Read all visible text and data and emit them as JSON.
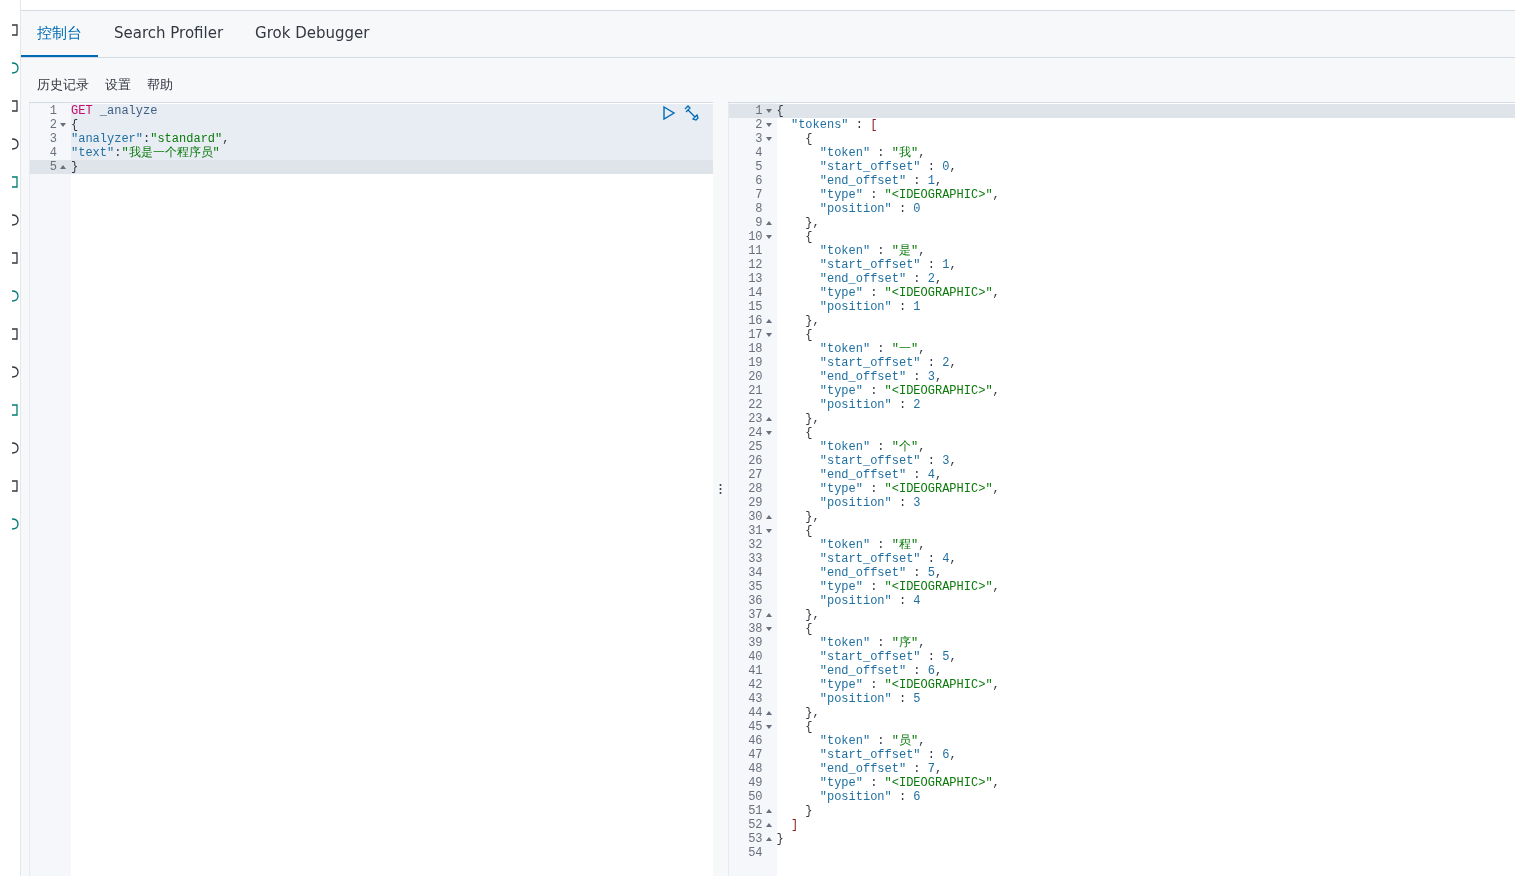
{
  "tabs": [
    {
      "label": "控制台",
      "selected": true
    },
    {
      "label": "Search Profiler",
      "selected": false
    },
    {
      "label": "Grok Debugger",
      "selected": false
    }
  ],
  "toolbar": [
    "历史记录",
    "设置",
    "帮助"
  ],
  "request": {
    "lines": [
      {
        "n": "1",
        "active": false,
        "kind": "plain",
        "parts": [
          {
            "kind": "method",
            "text": "GET"
          },
          {
            "kind": "path",
            "text": " _analyze"
          }
        ]
      },
      {
        "n": "2",
        "active": false,
        "kind": "fold-start",
        "parts": [
          {
            "kind": "punct",
            "text": "{"
          }
        ]
      },
      {
        "n": "3",
        "active": false,
        "kind": "plain",
        "parts": [
          {
            "kind": "key",
            "text": "\"analyzer\""
          },
          {
            "kind": "punct",
            "text": ":"
          },
          {
            "kind": "string",
            "text": "\"standard\""
          },
          {
            "kind": "punct",
            "text": ","
          }
        ]
      },
      {
        "n": "4",
        "active": false,
        "kind": "plain",
        "parts": [
          {
            "kind": "key",
            "text": "\"text\""
          },
          {
            "kind": "punct",
            "text": ":"
          },
          {
            "kind": "string",
            "text": "\"我是一个程序员\""
          }
        ]
      },
      {
        "n": "5",
        "active": true,
        "kind": "fold-end",
        "parts": [
          {
            "kind": "punct",
            "text": "}"
          }
        ]
      }
    ]
  },
  "response": {
    "lines": [
      {
        "n": "1",
        "active": true,
        "kind": "fold-start",
        "parts": [
          {
            "kind": "punct",
            "text": "{"
          }
        ]
      },
      {
        "n": "2",
        "active": false,
        "kind": "fold-start",
        "parts": [
          {
            "kind": "key",
            "text": "  \"tokens\""
          },
          {
            "kind": "punct",
            "text": " : "
          },
          {
            "kind": "bracket",
            "text": "["
          }
        ]
      },
      {
        "n": "3",
        "active": false,
        "kind": "fold-start",
        "parts": [
          {
            "kind": "punct",
            "text": "    {"
          }
        ]
      },
      {
        "n": "4",
        "active": false,
        "kind": "plain",
        "parts": [
          {
            "kind": "key",
            "text": "      \"token\""
          },
          {
            "kind": "punct",
            "text": " : "
          },
          {
            "kind": "string",
            "text": "\"我\""
          },
          {
            "kind": "punct",
            "text": ","
          }
        ]
      },
      {
        "n": "5",
        "active": false,
        "kind": "plain",
        "parts": [
          {
            "kind": "key",
            "text": "      \"start_offset\""
          },
          {
            "kind": "punct",
            "text": " : "
          },
          {
            "kind": "number",
            "text": "0"
          },
          {
            "kind": "punct",
            "text": ","
          }
        ]
      },
      {
        "n": "6",
        "active": false,
        "kind": "plain",
        "parts": [
          {
            "kind": "key",
            "text": "      \"end_offset\""
          },
          {
            "kind": "punct",
            "text": " : "
          },
          {
            "kind": "number",
            "text": "1"
          },
          {
            "kind": "punct",
            "text": ","
          }
        ]
      },
      {
        "n": "7",
        "active": false,
        "kind": "plain",
        "parts": [
          {
            "kind": "key",
            "text": "      \"type\""
          },
          {
            "kind": "punct",
            "text": " : "
          },
          {
            "kind": "string",
            "text": "\"<IDEOGRAPHIC>\""
          },
          {
            "kind": "punct",
            "text": ","
          }
        ]
      },
      {
        "n": "8",
        "active": false,
        "kind": "plain",
        "parts": [
          {
            "kind": "key",
            "text": "      \"position\""
          },
          {
            "kind": "punct",
            "text": " : "
          },
          {
            "kind": "number",
            "text": "0"
          }
        ]
      },
      {
        "n": "9",
        "active": false,
        "kind": "fold-end",
        "parts": [
          {
            "kind": "punct",
            "text": "    },"
          }
        ]
      },
      {
        "n": "10",
        "active": false,
        "kind": "fold-start",
        "parts": [
          {
            "kind": "punct",
            "text": "    {"
          }
        ]
      },
      {
        "n": "11",
        "active": false,
        "kind": "plain",
        "parts": [
          {
            "kind": "key",
            "text": "      \"token\""
          },
          {
            "kind": "punct",
            "text": " : "
          },
          {
            "kind": "string",
            "text": "\"是\""
          },
          {
            "kind": "punct",
            "text": ","
          }
        ]
      },
      {
        "n": "12",
        "active": false,
        "kind": "plain",
        "parts": [
          {
            "kind": "key",
            "text": "      \"start_offset\""
          },
          {
            "kind": "punct",
            "text": " : "
          },
          {
            "kind": "number",
            "text": "1"
          },
          {
            "kind": "punct",
            "text": ","
          }
        ]
      },
      {
        "n": "13",
        "active": false,
        "kind": "plain",
        "parts": [
          {
            "kind": "key",
            "text": "      \"end_offset\""
          },
          {
            "kind": "punct",
            "text": " : "
          },
          {
            "kind": "number",
            "text": "2"
          },
          {
            "kind": "punct",
            "text": ","
          }
        ]
      },
      {
        "n": "14",
        "active": false,
        "kind": "plain",
        "parts": [
          {
            "kind": "key",
            "text": "      \"type\""
          },
          {
            "kind": "punct",
            "text": " : "
          },
          {
            "kind": "string",
            "text": "\"<IDEOGRAPHIC>\""
          },
          {
            "kind": "punct",
            "text": ","
          }
        ]
      },
      {
        "n": "15",
        "active": false,
        "kind": "plain",
        "parts": [
          {
            "kind": "key",
            "text": "      \"position\""
          },
          {
            "kind": "punct",
            "text": " : "
          },
          {
            "kind": "number",
            "text": "1"
          }
        ]
      },
      {
        "n": "16",
        "active": false,
        "kind": "fold-end",
        "parts": [
          {
            "kind": "punct",
            "text": "    },"
          }
        ]
      },
      {
        "n": "17",
        "active": false,
        "kind": "fold-start",
        "parts": [
          {
            "kind": "punct",
            "text": "    {"
          }
        ]
      },
      {
        "n": "18",
        "active": false,
        "kind": "plain",
        "parts": [
          {
            "kind": "key",
            "text": "      \"token\""
          },
          {
            "kind": "punct",
            "text": " : "
          },
          {
            "kind": "string",
            "text": "\"一\""
          },
          {
            "kind": "punct",
            "text": ","
          }
        ]
      },
      {
        "n": "19",
        "active": false,
        "kind": "plain",
        "parts": [
          {
            "kind": "key",
            "text": "      \"start_offset\""
          },
          {
            "kind": "punct",
            "text": " : "
          },
          {
            "kind": "number",
            "text": "2"
          },
          {
            "kind": "punct",
            "text": ","
          }
        ]
      },
      {
        "n": "20",
        "active": false,
        "kind": "plain",
        "parts": [
          {
            "kind": "key",
            "text": "      \"end_offset\""
          },
          {
            "kind": "punct",
            "text": " : "
          },
          {
            "kind": "number",
            "text": "3"
          },
          {
            "kind": "punct",
            "text": ","
          }
        ]
      },
      {
        "n": "21",
        "active": false,
        "kind": "plain",
        "parts": [
          {
            "kind": "key",
            "text": "      \"type\""
          },
          {
            "kind": "punct",
            "text": " : "
          },
          {
            "kind": "string",
            "text": "\"<IDEOGRAPHIC>\""
          },
          {
            "kind": "punct",
            "text": ","
          }
        ]
      },
      {
        "n": "22",
        "active": false,
        "kind": "plain",
        "parts": [
          {
            "kind": "key",
            "text": "      \"position\""
          },
          {
            "kind": "punct",
            "text": " : "
          },
          {
            "kind": "number",
            "text": "2"
          }
        ]
      },
      {
        "n": "23",
        "active": false,
        "kind": "fold-end",
        "parts": [
          {
            "kind": "punct",
            "text": "    },"
          }
        ]
      },
      {
        "n": "24",
        "active": false,
        "kind": "fold-start",
        "parts": [
          {
            "kind": "punct",
            "text": "    {"
          }
        ]
      },
      {
        "n": "25",
        "active": false,
        "kind": "plain",
        "parts": [
          {
            "kind": "key",
            "text": "      \"token\""
          },
          {
            "kind": "punct",
            "text": " : "
          },
          {
            "kind": "string",
            "text": "\"个\""
          },
          {
            "kind": "punct",
            "text": ","
          }
        ]
      },
      {
        "n": "26",
        "active": false,
        "kind": "plain",
        "parts": [
          {
            "kind": "key",
            "text": "      \"start_offset\""
          },
          {
            "kind": "punct",
            "text": " : "
          },
          {
            "kind": "number",
            "text": "3"
          },
          {
            "kind": "punct",
            "text": ","
          }
        ]
      },
      {
        "n": "27",
        "active": false,
        "kind": "plain",
        "parts": [
          {
            "kind": "key",
            "text": "      \"end_offset\""
          },
          {
            "kind": "punct",
            "text": " : "
          },
          {
            "kind": "number",
            "text": "4"
          },
          {
            "kind": "punct",
            "text": ","
          }
        ]
      },
      {
        "n": "28",
        "active": false,
        "kind": "plain",
        "parts": [
          {
            "kind": "key",
            "text": "      \"type\""
          },
          {
            "kind": "punct",
            "text": " : "
          },
          {
            "kind": "string",
            "text": "\"<IDEOGRAPHIC>\""
          },
          {
            "kind": "punct",
            "text": ","
          }
        ]
      },
      {
        "n": "29",
        "active": false,
        "kind": "plain",
        "parts": [
          {
            "kind": "key",
            "text": "      \"position\""
          },
          {
            "kind": "punct",
            "text": " : "
          },
          {
            "kind": "number",
            "text": "3"
          }
        ]
      },
      {
        "n": "30",
        "active": false,
        "kind": "fold-end",
        "parts": [
          {
            "kind": "punct",
            "text": "    },"
          }
        ]
      },
      {
        "n": "31",
        "active": false,
        "kind": "fold-start",
        "parts": [
          {
            "kind": "punct",
            "text": "    {"
          }
        ]
      },
      {
        "n": "32",
        "active": false,
        "kind": "plain",
        "parts": [
          {
            "kind": "key",
            "text": "      \"token\""
          },
          {
            "kind": "punct",
            "text": " : "
          },
          {
            "kind": "string",
            "text": "\"程\""
          },
          {
            "kind": "punct",
            "text": ","
          }
        ]
      },
      {
        "n": "33",
        "active": false,
        "kind": "plain",
        "parts": [
          {
            "kind": "key",
            "text": "      \"start_offset\""
          },
          {
            "kind": "punct",
            "text": " : "
          },
          {
            "kind": "number",
            "text": "4"
          },
          {
            "kind": "punct",
            "text": ","
          }
        ]
      },
      {
        "n": "34",
        "active": false,
        "kind": "plain",
        "parts": [
          {
            "kind": "key",
            "text": "      \"end_offset\""
          },
          {
            "kind": "punct",
            "text": " : "
          },
          {
            "kind": "number",
            "text": "5"
          },
          {
            "kind": "punct",
            "text": ","
          }
        ]
      },
      {
        "n": "35",
        "active": false,
        "kind": "plain",
        "parts": [
          {
            "kind": "key",
            "text": "      \"type\""
          },
          {
            "kind": "punct",
            "text": " : "
          },
          {
            "kind": "string",
            "text": "\"<IDEOGRAPHIC>\""
          },
          {
            "kind": "punct",
            "text": ","
          }
        ]
      },
      {
        "n": "36",
        "active": false,
        "kind": "plain",
        "parts": [
          {
            "kind": "key",
            "text": "      \"position\""
          },
          {
            "kind": "punct",
            "text": " : "
          },
          {
            "kind": "number",
            "text": "4"
          }
        ]
      },
      {
        "n": "37",
        "active": false,
        "kind": "fold-end",
        "parts": [
          {
            "kind": "punct",
            "text": "    },"
          }
        ]
      },
      {
        "n": "38",
        "active": false,
        "kind": "fold-start",
        "parts": [
          {
            "kind": "punct",
            "text": "    {"
          }
        ]
      },
      {
        "n": "39",
        "active": false,
        "kind": "plain",
        "parts": [
          {
            "kind": "key",
            "text": "      \"token\""
          },
          {
            "kind": "punct",
            "text": " : "
          },
          {
            "kind": "string",
            "text": "\"序\""
          },
          {
            "kind": "punct",
            "text": ","
          }
        ]
      },
      {
        "n": "40",
        "active": false,
        "kind": "plain",
        "parts": [
          {
            "kind": "key",
            "text": "      \"start_offset\""
          },
          {
            "kind": "punct",
            "text": " : "
          },
          {
            "kind": "number",
            "text": "5"
          },
          {
            "kind": "punct",
            "text": ","
          }
        ]
      },
      {
        "n": "41",
        "active": false,
        "kind": "plain",
        "parts": [
          {
            "kind": "key",
            "text": "      \"end_offset\""
          },
          {
            "kind": "punct",
            "text": " : "
          },
          {
            "kind": "number",
            "text": "6"
          },
          {
            "kind": "punct",
            "text": ","
          }
        ]
      },
      {
        "n": "42",
        "active": false,
        "kind": "plain",
        "parts": [
          {
            "kind": "key",
            "text": "      \"type\""
          },
          {
            "kind": "punct",
            "text": " : "
          },
          {
            "kind": "string",
            "text": "\"<IDEOGRAPHIC>\""
          },
          {
            "kind": "punct",
            "text": ","
          }
        ]
      },
      {
        "n": "43",
        "active": false,
        "kind": "plain",
        "parts": [
          {
            "kind": "key",
            "text": "      \"position\""
          },
          {
            "kind": "punct",
            "text": " : "
          },
          {
            "kind": "number",
            "text": "5"
          }
        ]
      },
      {
        "n": "44",
        "active": false,
        "kind": "fold-end",
        "parts": [
          {
            "kind": "punct",
            "text": "    },"
          }
        ]
      },
      {
        "n": "45",
        "active": false,
        "kind": "fold-start",
        "parts": [
          {
            "kind": "punct",
            "text": "    {"
          }
        ]
      },
      {
        "n": "46",
        "active": false,
        "kind": "plain",
        "parts": [
          {
            "kind": "key",
            "text": "      \"token\""
          },
          {
            "kind": "punct",
            "text": " : "
          },
          {
            "kind": "string",
            "text": "\"员\""
          },
          {
            "kind": "punct",
            "text": ","
          }
        ]
      },
      {
        "n": "47",
        "active": false,
        "kind": "plain",
        "parts": [
          {
            "kind": "key",
            "text": "      \"start_offset\""
          },
          {
            "kind": "punct",
            "text": " : "
          },
          {
            "kind": "number",
            "text": "6"
          },
          {
            "kind": "punct",
            "text": ","
          }
        ]
      },
      {
        "n": "48",
        "active": false,
        "kind": "plain",
        "parts": [
          {
            "kind": "key",
            "text": "      \"end_offset\""
          },
          {
            "kind": "punct",
            "text": " : "
          },
          {
            "kind": "number",
            "text": "7"
          },
          {
            "kind": "punct",
            "text": ","
          }
        ]
      },
      {
        "n": "49",
        "active": false,
        "kind": "plain",
        "parts": [
          {
            "kind": "key",
            "text": "      \"type\""
          },
          {
            "kind": "punct",
            "text": " : "
          },
          {
            "kind": "string",
            "text": "\"<IDEOGRAPHIC>\""
          },
          {
            "kind": "punct",
            "text": ","
          }
        ]
      },
      {
        "n": "50",
        "active": false,
        "kind": "plain",
        "parts": [
          {
            "kind": "key",
            "text": "      \"position\""
          },
          {
            "kind": "punct",
            "text": " : "
          },
          {
            "kind": "number",
            "text": "6"
          }
        ]
      },
      {
        "n": "51",
        "active": false,
        "kind": "fold-end",
        "parts": [
          {
            "kind": "punct",
            "text": "    }"
          }
        ]
      },
      {
        "n": "52",
        "active": false,
        "kind": "fold-end",
        "parts": [
          {
            "kind": "bracket",
            "text": "  ]"
          }
        ]
      },
      {
        "n": "53",
        "active": false,
        "kind": "fold-end",
        "parts": [
          {
            "kind": "punct",
            "text": "}"
          }
        ]
      },
      {
        "n": "54",
        "active": false,
        "kind": "plain"
      }
    ]
  }
}
